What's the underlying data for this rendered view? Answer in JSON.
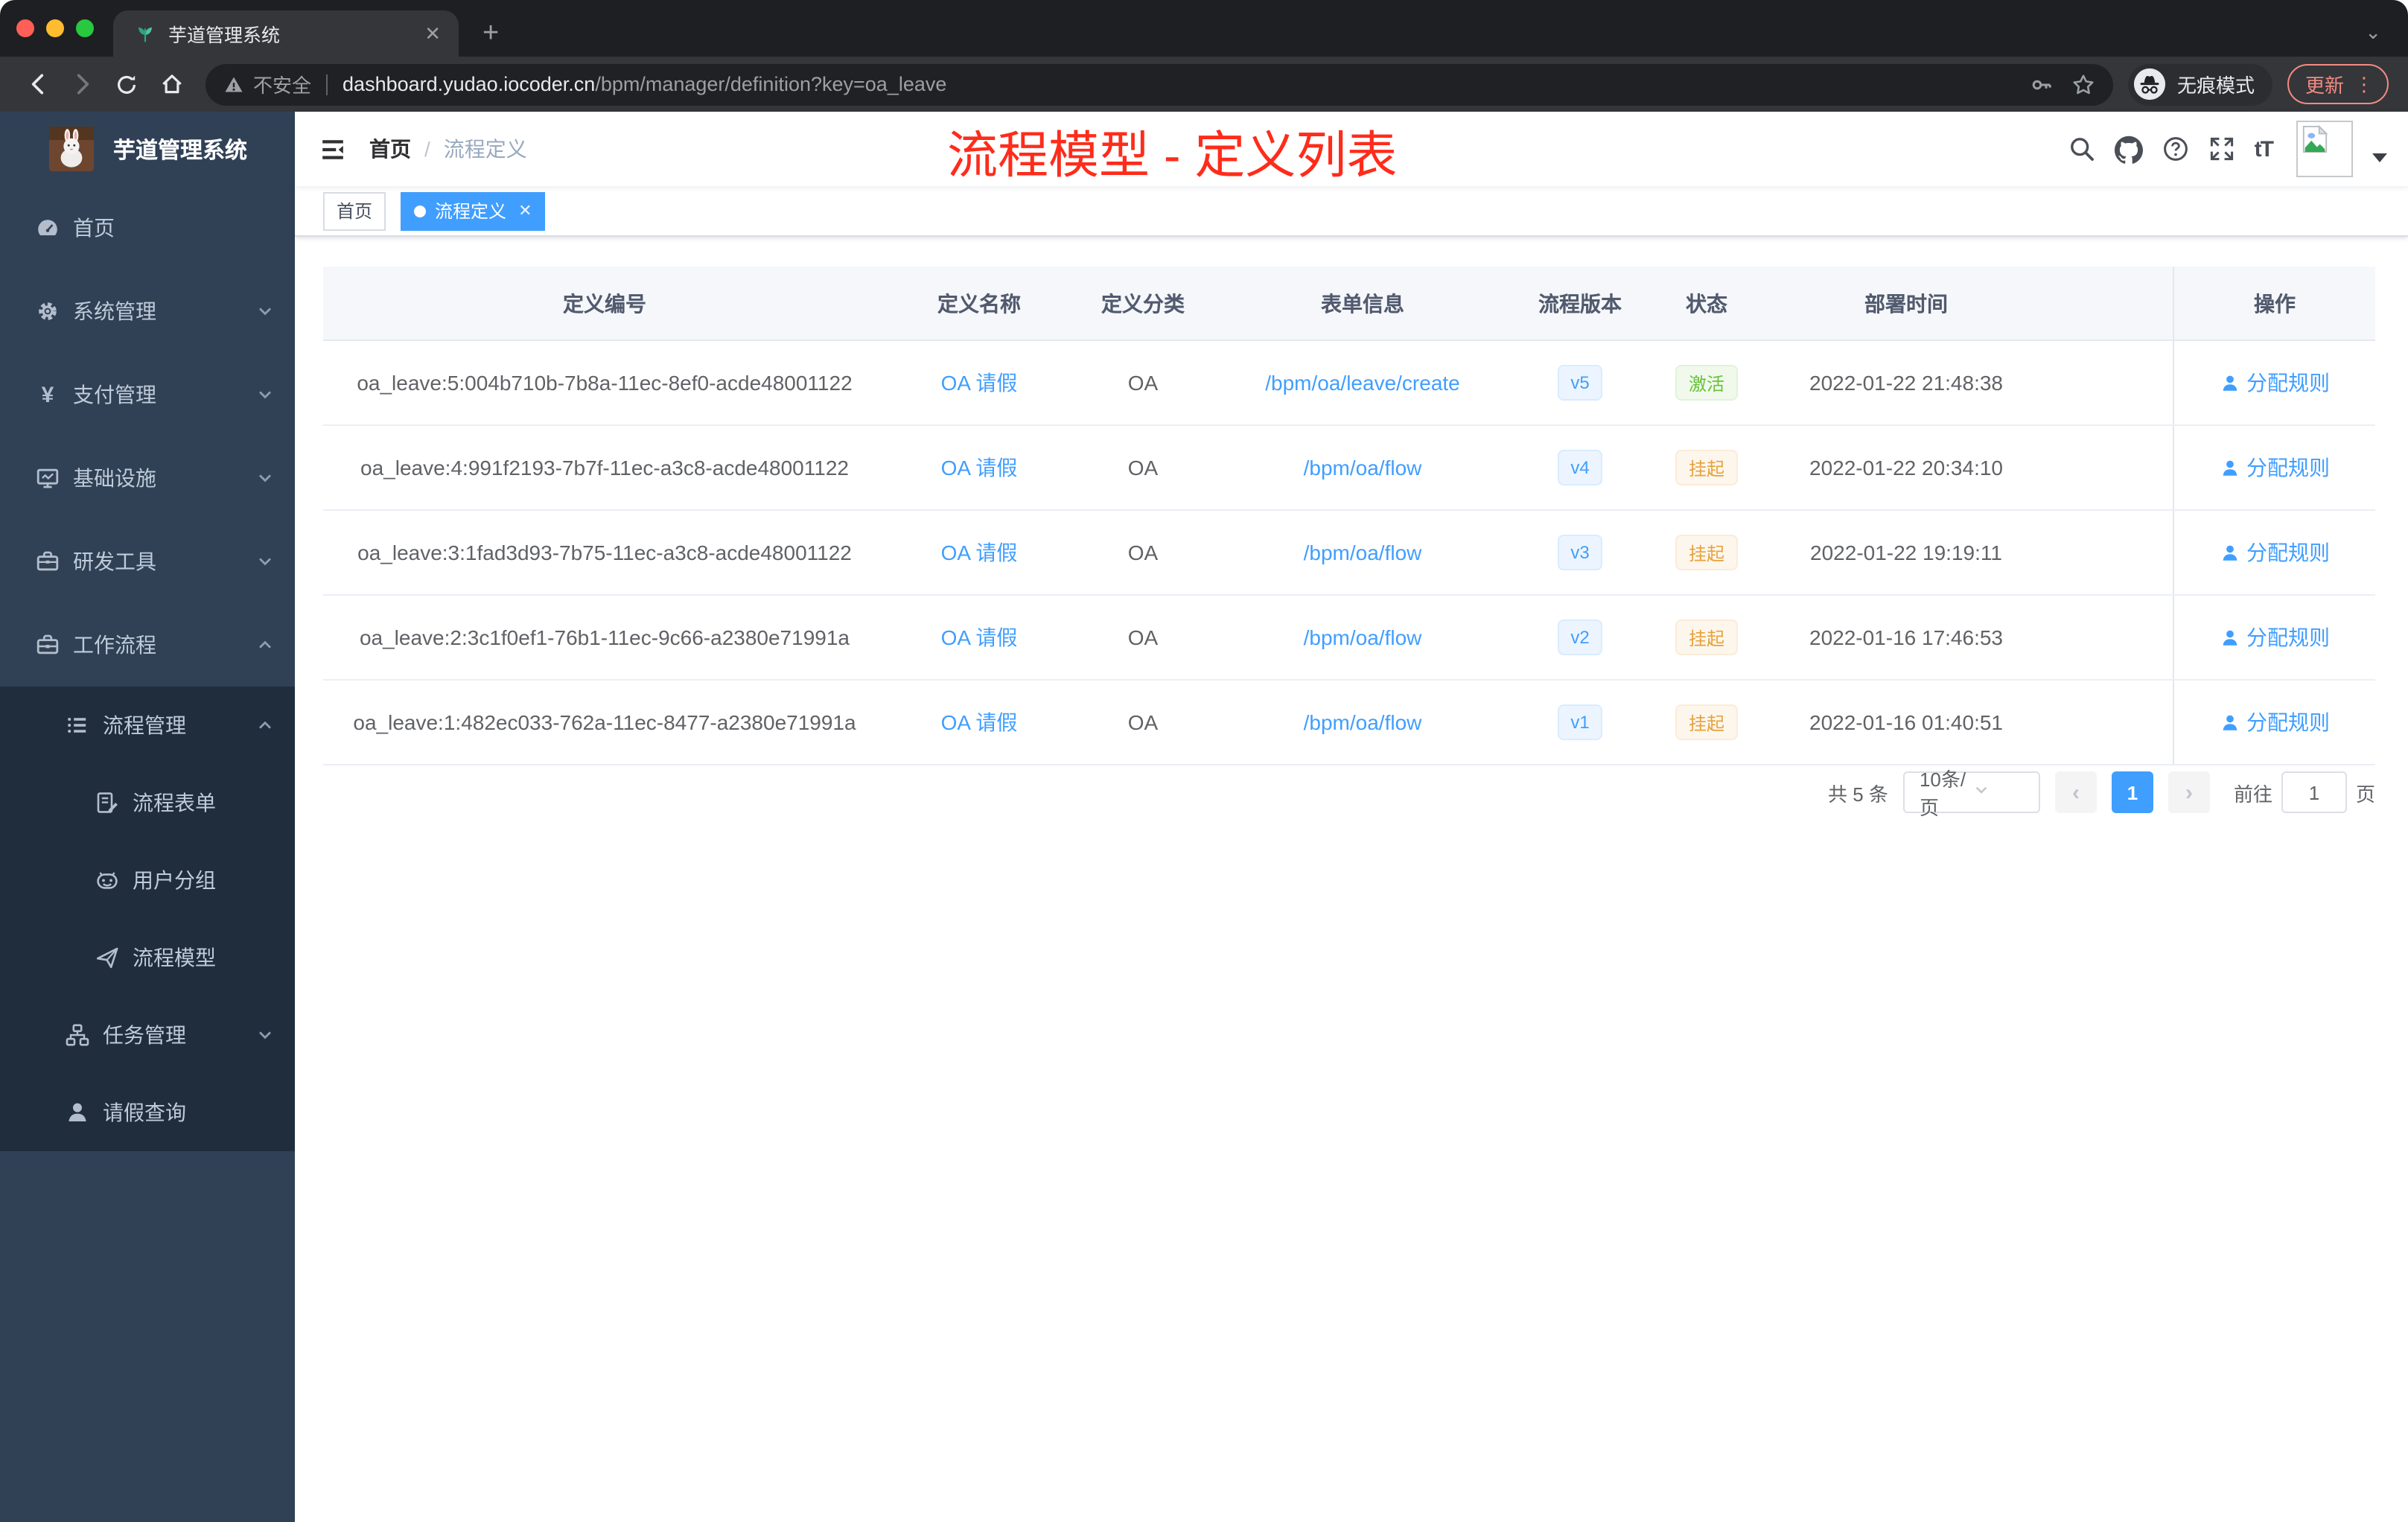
{
  "browser": {
    "tab_title": "芋道管理系统",
    "security_label": "不安全",
    "url_host": "dashboard.yudao.iocoder.cn",
    "url_path": "/bpm/manager/definition?key=oa_leave",
    "incognito_label": "无痕模式",
    "update_label": "更新"
  },
  "icons": {
    "close": "✕",
    "plus": "+",
    "chevron_down": "⌄",
    "more_vert": "⋮",
    "prev": "‹",
    "next": "›",
    "select_caret": "▾",
    "text_size": "tT"
  },
  "sidebar": {
    "logo_title": "芋道管理系统",
    "items": [
      {
        "label": "首页"
      },
      {
        "label": "系统管理"
      },
      {
        "label": "支付管理"
      },
      {
        "label": "基础设施"
      },
      {
        "label": "研发工具"
      },
      {
        "label": "工作流程"
      },
      {
        "label": "流程管理"
      },
      {
        "label": "流程表单"
      },
      {
        "label": "用户分组"
      },
      {
        "label": "流程模型"
      },
      {
        "label": "任务管理"
      },
      {
        "label": "请假查询"
      }
    ]
  },
  "header": {
    "breadcrumb_home": "首页",
    "breadcrumb_sep": "/",
    "breadcrumb_current": "流程定义",
    "annotation": "流程模型 - 定义列表"
  },
  "tags": {
    "home": "首页",
    "active": "流程定义"
  },
  "table": {
    "columns": [
      "定义编号",
      "定义名称",
      "定义分类",
      "表单信息",
      "流程版本",
      "状态",
      "部署时间",
      "操作"
    ],
    "rows": [
      {
        "id": "oa_leave:5:004b710b-7b8a-11ec-8ef0-acde48001122",
        "name": "OA 请假",
        "category": "OA",
        "form": "/bpm/oa/leave/create",
        "version": "v5",
        "status": "激活",
        "status_type": "active",
        "time": "2022-01-22 21:48:38",
        "action": "分配规则"
      },
      {
        "id": "oa_leave:4:991f2193-7b7f-11ec-a3c8-acde48001122",
        "name": "OA 请假",
        "category": "OA",
        "form": "/bpm/oa/flow",
        "version": "v4",
        "status": "挂起",
        "status_type": "suspended",
        "time": "2022-01-22 20:34:10",
        "action": "分配规则"
      },
      {
        "id": "oa_leave:3:1fad3d93-7b75-11ec-a3c8-acde48001122",
        "name": "OA 请假",
        "category": "OA",
        "form": "/bpm/oa/flow",
        "version": "v3",
        "status": "挂起",
        "status_type": "suspended",
        "time": "2022-01-22 19:19:11",
        "action": "分配规则"
      },
      {
        "id": "oa_leave:2:3c1f0ef1-76b1-11ec-9c66-a2380e71991a",
        "name": "OA 请假",
        "category": "OA",
        "form": "/bpm/oa/flow",
        "version": "v2",
        "status": "挂起",
        "status_type": "suspended",
        "time": "2022-01-16 17:46:53",
        "action": "分配规则"
      },
      {
        "id": "oa_leave:1:482ec033-762a-11ec-8477-a2380e71991a",
        "name": "OA 请假",
        "category": "OA",
        "form": "/bpm/oa/flow",
        "version": "v1",
        "status": "挂起",
        "status_type": "suspended",
        "time": "2022-01-16 01:40:51",
        "action": "分配规则"
      }
    ]
  },
  "pagination": {
    "total": "共 5 条",
    "page_size": "10条/页",
    "current": "1",
    "goto_label": "前往",
    "goto_value": "1",
    "page_unit": "页"
  },
  "colors": {
    "accent": "#409eff",
    "annotation_red": "#fe2c1b",
    "status_active": "#67c23a",
    "status_suspended": "#e6a23c",
    "sidebar_bg": "#304156",
    "sidebar_sub_bg": "#1f2d3d"
  }
}
